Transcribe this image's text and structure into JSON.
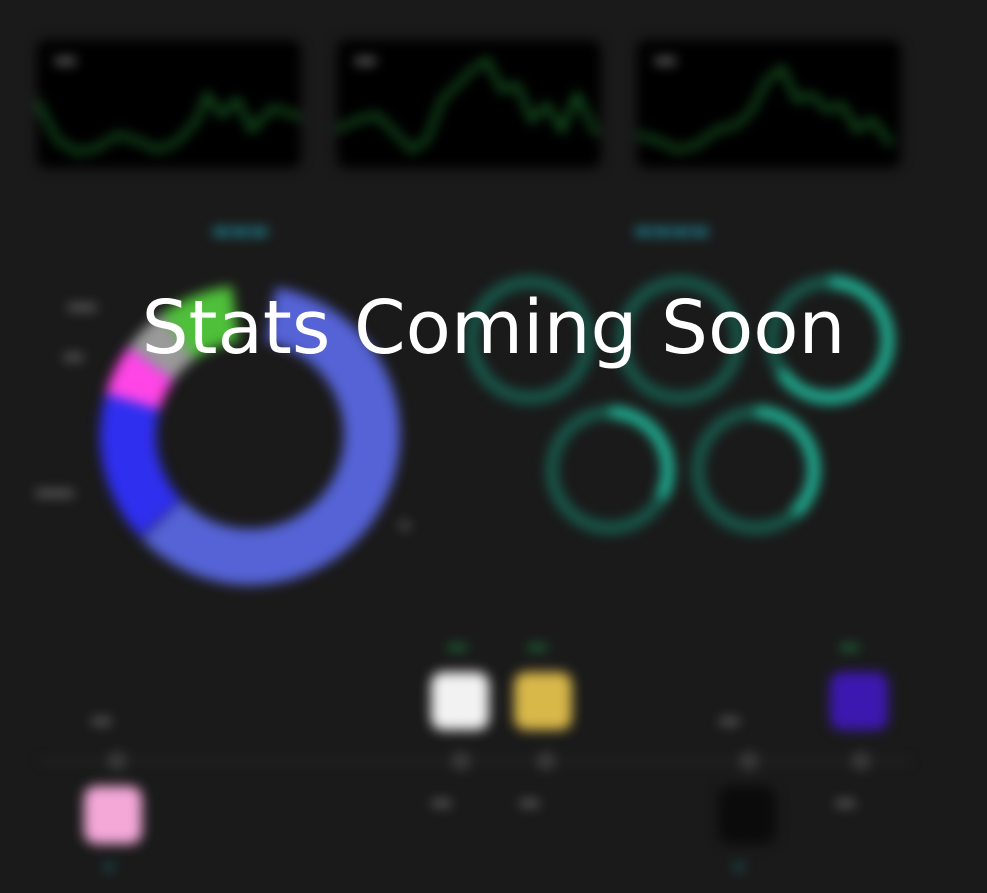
{
  "overlay": {
    "heading": "Stats Coming Soon"
  },
  "colors": {
    "accent": "#1f8fa0",
    "line": "#1f7a30",
    "ring": "#20b89a",
    "donut": [
      "#5563d6",
      "#2f2ff0",
      "#ff45e6",
      "#9a9a9a",
      "#4fc03a"
    ]
  }
}
